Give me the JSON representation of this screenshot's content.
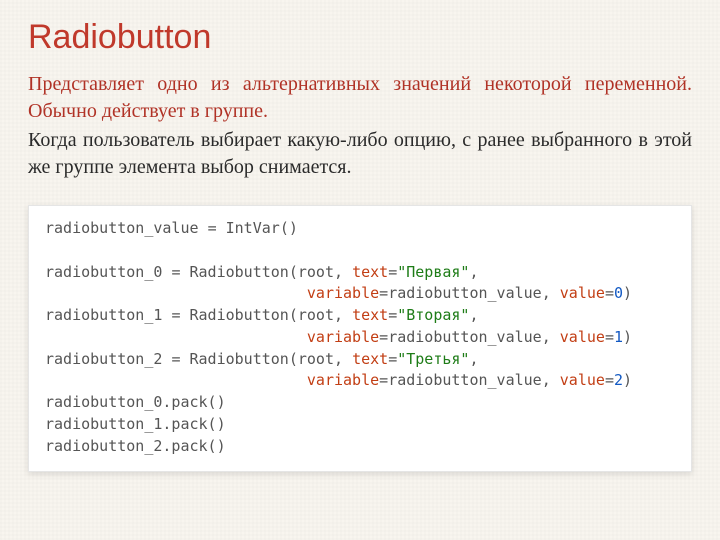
{
  "title": "Radiobutton",
  "desc_red": "Представляет одно из альтернативных значений некоторой переменной. Обычно действует в группе.",
  "desc_dark": "Когда пользователь выбирает какую-либо опцию, с ранее выбранного в этой же группе элемента выбор снимается.",
  "code": {
    "l1_a": "radiobutton_value ",
    "l1_b": "=",
    "l1_c": " IntVar",
    "l1_d": "()",
    "l3_a": "radiobutton_0 ",
    "l3_b": "=",
    "l3_c": " Radiobutton",
    "l3_d": "(",
    "l3_e": "root",
    "l3_f": ", ",
    "l3_g": "text",
    "l3_h": "=",
    "l3_i": "\"Первая\"",
    "l3_j": ",",
    "l4_pad": "                             ",
    "l4_a": "variable",
    "l4_b": "=",
    "l4_c": "radiobutton_value",
    "l4_d": ", ",
    "l4_e": "value",
    "l4_f": "=",
    "l4_g": "0",
    "l4_h": ")",
    "l5_a": "radiobutton_1 ",
    "l5_b": "=",
    "l5_c": " Radiobutton",
    "l5_d": "(",
    "l5_e": "root",
    "l5_f": ", ",
    "l5_g": "text",
    "l5_h": "=",
    "l5_i": "\"Вторая\"",
    "l5_j": ",",
    "l6_pad": "                             ",
    "l6_a": "variable",
    "l6_b": "=",
    "l6_c": "radiobutton_value",
    "l6_d": ", ",
    "l6_e": "value",
    "l6_f": "=",
    "l6_g": "1",
    "l6_h": ")",
    "l7_a": "radiobutton_2 ",
    "l7_b": "=",
    "l7_c": " Radiobutton",
    "l7_d": "(",
    "l7_e": "root",
    "l7_f": ", ",
    "l7_g": "text",
    "l7_h": "=",
    "l7_i": "\"Третья\"",
    "l7_j": ",",
    "l8_pad": "                             ",
    "l8_a": "variable",
    "l8_b": "=",
    "l8_c": "radiobutton_value",
    "l8_d": ", ",
    "l8_e": "value",
    "l8_f": "=",
    "l8_g": "2",
    "l8_h": ")",
    "l9": "radiobutton_0.pack()",
    "l10": "radiobutton_1.pack()",
    "l11": "radiobutton_2.pack()"
  }
}
